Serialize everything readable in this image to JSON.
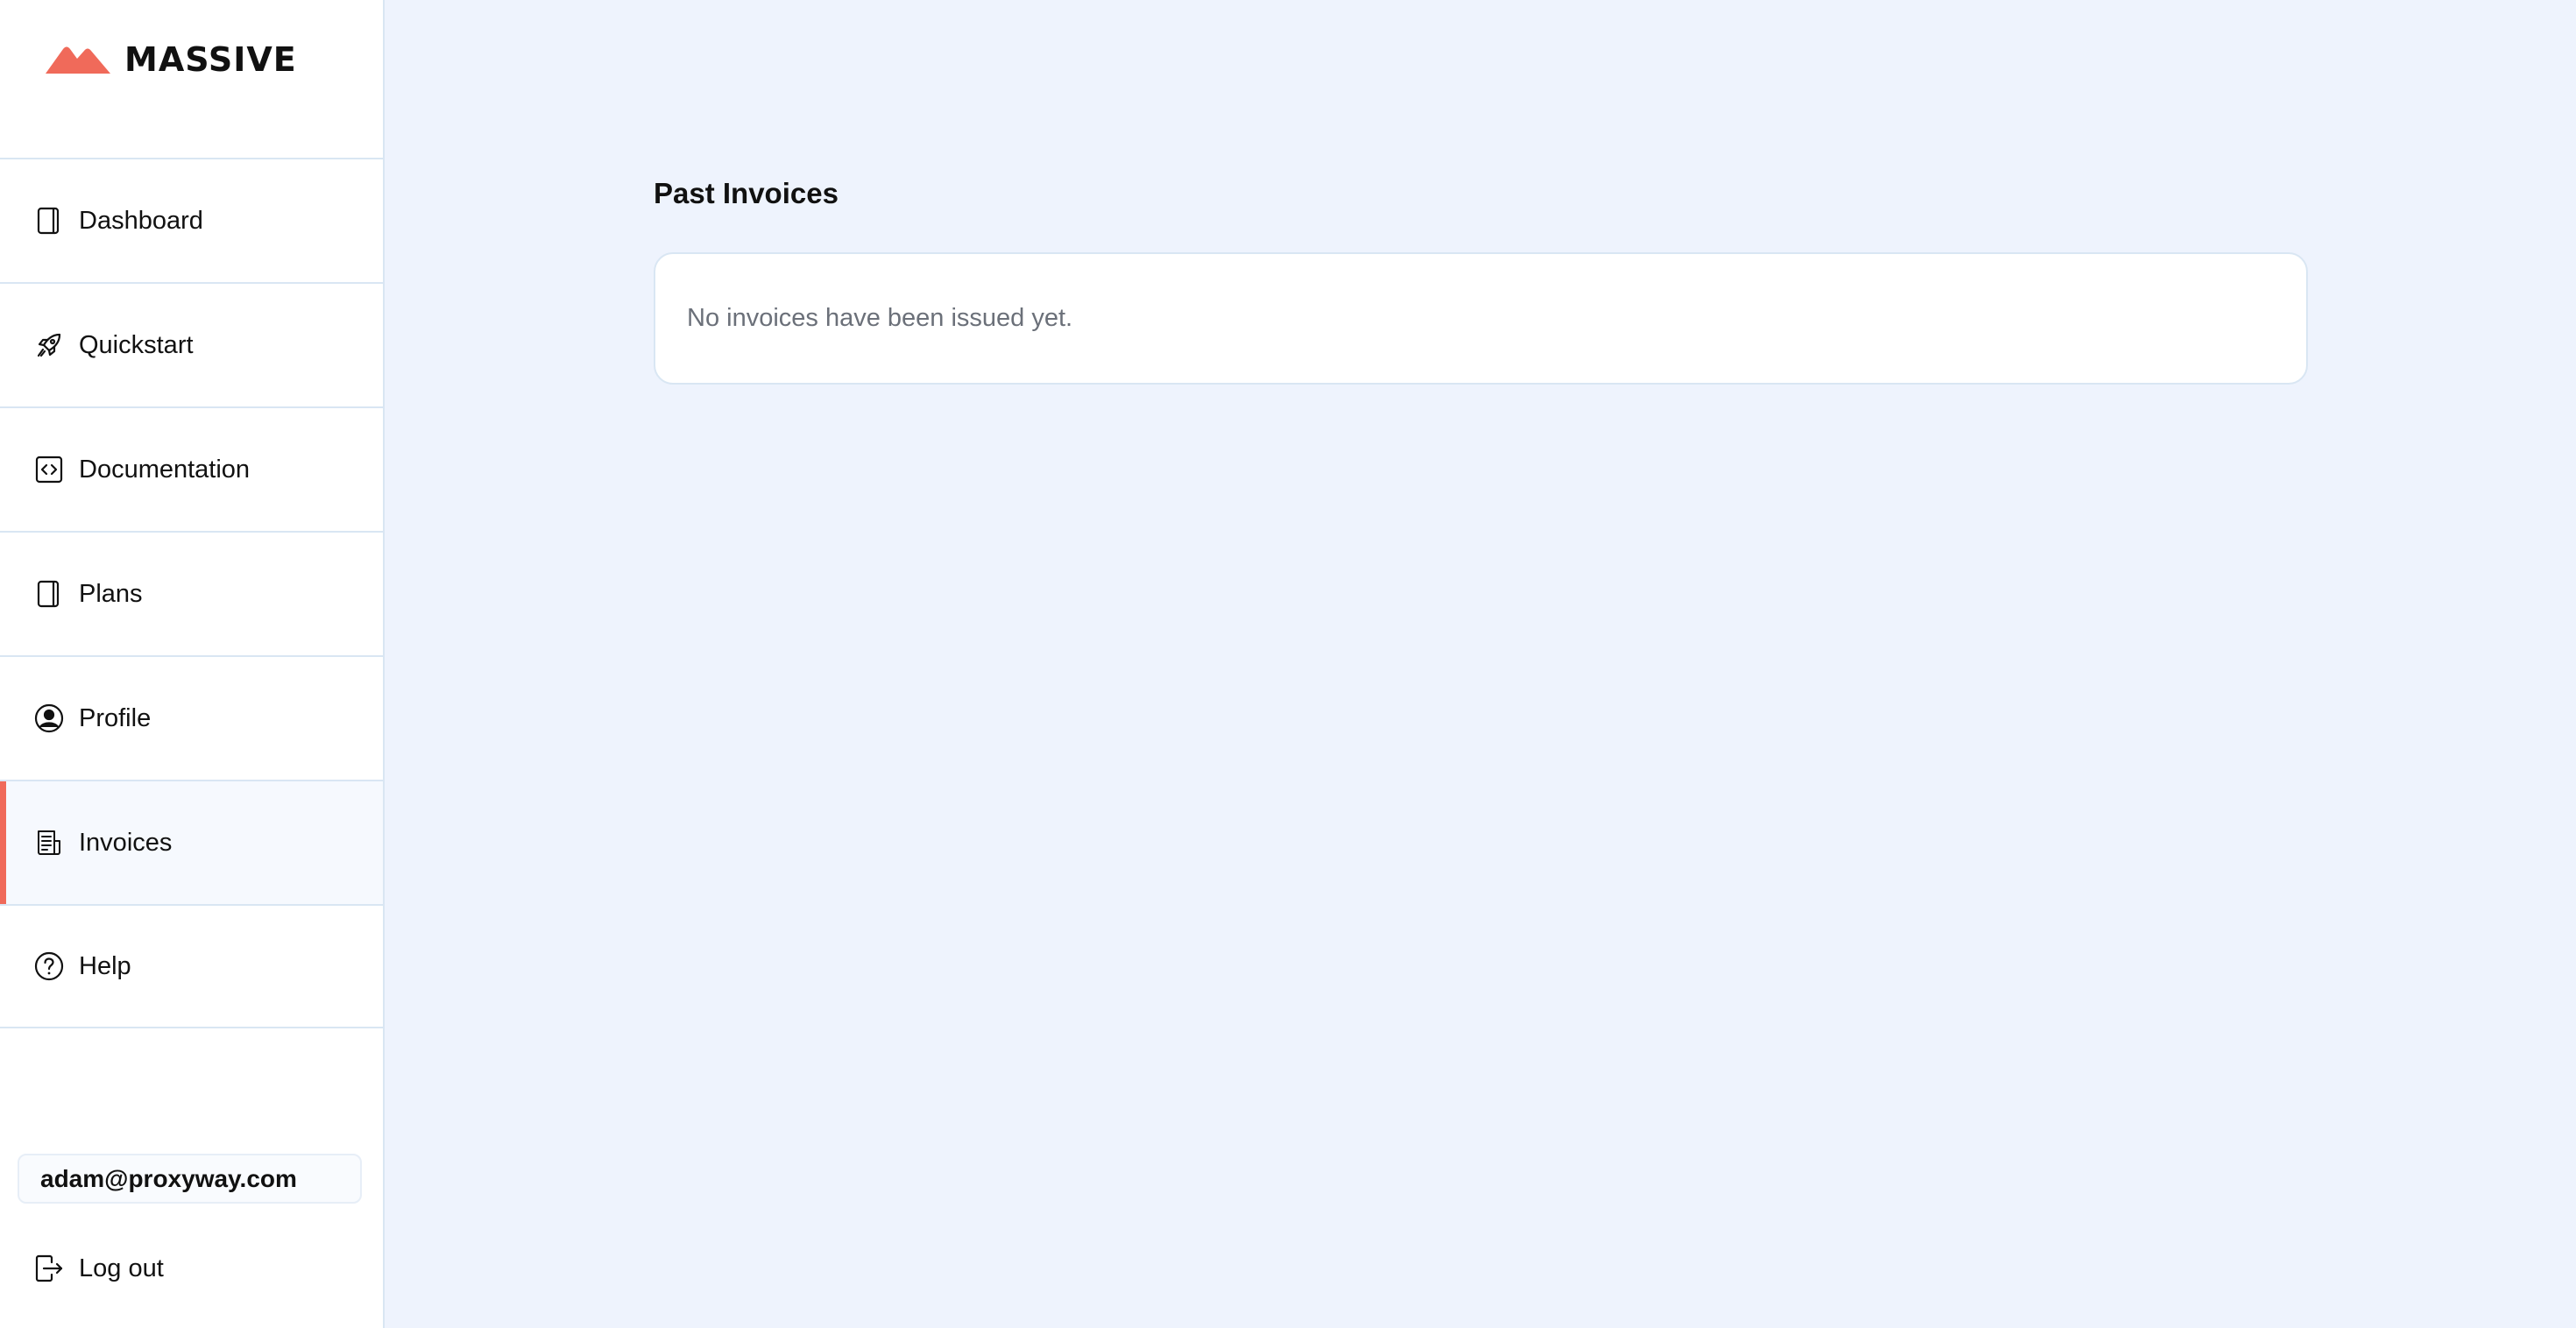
{
  "brand": {
    "name": "MASSIVE",
    "accent": "#f06a5a"
  },
  "sidebar": {
    "items": [
      {
        "label": "Dashboard",
        "icon": "dashboard-icon"
      },
      {
        "label": "Quickstart",
        "icon": "rocket-icon"
      },
      {
        "label": "Documentation",
        "icon": "code-icon"
      },
      {
        "label": "Plans",
        "icon": "plans-icon"
      },
      {
        "label": "Profile",
        "icon": "user-circle-icon"
      },
      {
        "label": "Invoices",
        "icon": "invoice-icon",
        "active": true
      },
      {
        "label": "Help",
        "icon": "help-circle-icon"
      }
    ],
    "user_email": "adam@proxyway.com",
    "logout_label": "Log out"
  },
  "main": {
    "title": "Past Invoices",
    "empty_message": "No invoices have been issued yet."
  }
}
